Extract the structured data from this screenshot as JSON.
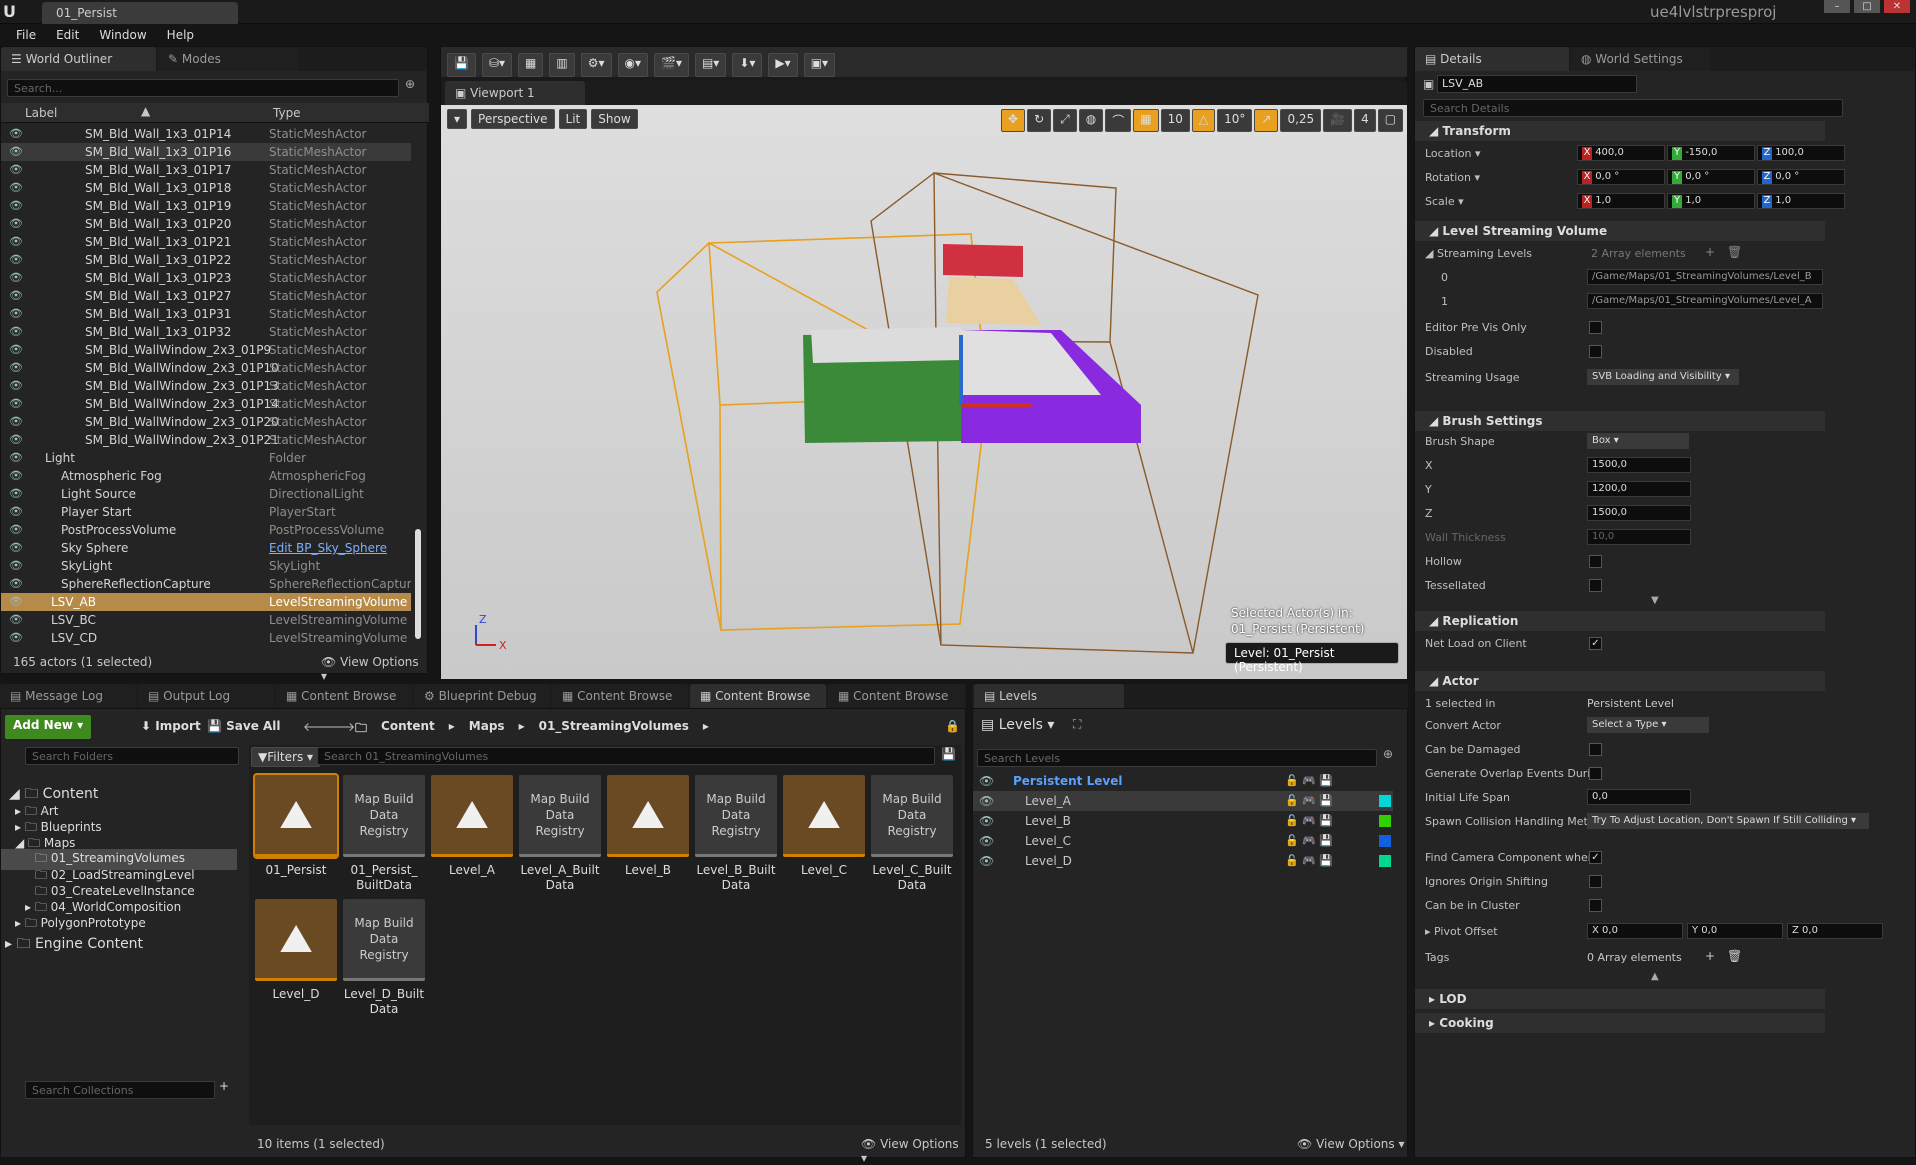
{
  "app": {
    "tab_title": "01_Persist",
    "project": "ue4lvlstrpresproj"
  },
  "menu": [
    "File",
    "Edit",
    "Window",
    "Help"
  ],
  "left_tabs": [
    "World Outliner",
    "Modes"
  ],
  "outliner": {
    "search_placeholder": "Search...",
    "col_label": "Label",
    "col_type": "Type",
    "rows": [
      {
        "label": "SM_Bld_Wall_1x3_01P14",
        "type": "StaticMeshActor"
      },
      {
        "label": "SM_Bld_Wall_1x3_01P16",
        "type": "StaticMeshActor"
      },
      {
        "label": "SM_Bld_Wall_1x3_01P17",
        "type": "StaticMeshActor"
      },
      {
        "label": "SM_Bld_Wall_1x3_01P18",
        "type": "StaticMeshActor"
      },
      {
        "label": "SM_Bld_Wall_1x3_01P19",
        "type": "StaticMeshActor"
      },
      {
        "label": "SM_Bld_Wall_1x3_01P20",
        "type": "StaticMeshActor"
      },
      {
        "label": "SM_Bld_Wall_1x3_01P21",
        "type": "StaticMeshActor"
      },
      {
        "label": "SM_Bld_Wall_1x3_01P22",
        "type": "StaticMeshActor"
      },
      {
        "label": "SM_Bld_Wall_1x3_01P23",
        "type": "StaticMeshActor"
      },
      {
        "label": "SM_Bld_Wall_1x3_01P27",
        "type": "StaticMeshActor"
      },
      {
        "label": "SM_Bld_Wall_1x3_01P31",
        "type": "StaticMeshActor"
      },
      {
        "label": "SM_Bld_Wall_1x3_01P32",
        "type": "StaticMeshActor"
      },
      {
        "label": "SM_Bld_WallWindow_2x3_01P9",
        "type": "StaticMeshActor"
      },
      {
        "label": "SM_Bld_WallWindow_2x3_01P10",
        "type": "StaticMeshActor"
      },
      {
        "label": "SM_Bld_WallWindow_2x3_01P13",
        "type": "StaticMeshActor"
      },
      {
        "label": "SM_Bld_WallWindow_2x3_01P14",
        "type": "StaticMeshActor"
      },
      {
        "label": "SM_Bld_WallWindow_2x3_01P20",
        "type": "StaticMeshActor"
      },
      {
        "label": "SM_Bld_WallWindow_2x3_01P21",
        "type": "StaticMeshActor"
      },
      {
        "label": "Light",
        "type": "Folder"
      },
      {
        "label": "Atmospheric Fog",
        "type": "AtmosphericFog"
      },
      {
        "label": "Light Source",
        "type": "DirectionalLight"
      },
      {
        "label": "Player Start",
        "type": "PlayerStart"
      },
      {
        "label": "PostProcessVolume",
        "type": "PostProcessVolume"
      },
      {
        "label": "Sky Sphere",
        "type": "Edit BP_Sky_Sphere"
      },
      {
        "label": "SkyLight",
        "type": "SkyLight"
      },
      {
        "label": "SphereReflectionCapture",
        "type": "SphereReflectionCapture"
      },
      {
        "label": "LSV_AB",
        "type": "LevelStreamingVolume"
      },
      {
        "label": "LSV_BC",
        "type": "LevelStreamingVolume"
      },
      {
        "label": "LSV_CD",
        "type": "LevelStreamingVolume"
      }
    ],
    "status": "165 actors (1 selected)",
    "view_options": "View Options"
  },
  "viewport": {
    "tab": "Viewport 1",
    "perspective": "Perspective",
    "lit": "Lit",
    "show": "Show",
    "grid": "10",
    "rot": "10°",
    "scale": "0,25",
    "speed": "4",
    "selected_line1": "Selected Actor(s) in:",
    "selected_line2": "01_Persist (Persistent)",
    "level_label": "Level:  01_Persist (Persistent)"
  },
  "bottom_tabs": [
    "Message Log",
    "Output Log",
    "Content Browse",
    "Blueprint Debug",
    "Content Browse",
    "Content Browse",
    "Content Browse"
  ],
  "content": {
    "add_new": "Add New",
    "import": "Import",
    "save_all": "Save All",
    "path": [
      "Content",
      "Maps",
      "01_StreamingVolumes"
    ],
    "search_folders": "Search Folders",
    "filters": "Filters",
    "search_assets": "Search 01_StreamingVolumes",
    "folders": [
      "Content",
      "Art",
      "Blueprints",
      "Maps",
      "01_StreamingVolumes",
      "02_LoadStreamingLevel",
      "03_CreateLevelInstance",
      "04_WorldComposition",
      "PolygonPrototype",
      "Engine Content"
    ],
    "assets": [
      {
        "name": "01_Persist",
        "kind": "map"
      },
      {
        "name": "01_Persist_ BuiltData",
        "kind": "reg"
      },
      {
        "name": "Level_A",
        "kind": "map"
      },
      {
        "name": "Level_A_Built Data",
        "kind": "reg"
      },
      {
        "name": "Level_B",
        "kind": "map"
      },
      {
        "name": "Level_B_Built Data",
        "kind": "reg"
      },
      {
        "name": "Level_C",
        "kind": "map"
      },
      {
        "name": "Level_C_Built Data",
        "kind": "reg"
      },
      {
        "name": "Level_D",
        "kind": "map"
      },
      {
        "name": "Level_D_Built Data",
        "kind": "reg"
      }
    ],
    "registry_label": "Map Build Data Registry",
    "search_collections": "Search Collections",
    "status": "10 items (1 selected)",
    "view_options": "View Options"
  },
  "levels": {
    "tab": "Levels",
    "title": "Levels",
    "search": "Search Levels",
    "rows": [
      {
        "name": "Persistent Level",
        "color": ""
      },
      {
        "name": "Level_A",
        "color": "#00d8d8"
      },
      {
        "name": "Level_B",
        "color": "#30d000"
      },
      {
        "name": "Level_C",
        "color": "#1060e0"
      },
      {
        "name": "Level_D",
        "color": "#00d890"
      }
    ],
    "status": "5 levels (1 selected)",
    "view_options": "View Options"
  },
  "details": {
    "tabs": [
      "Details",
      "World Settings"
    ],
    "actor_name": "LSV_AB",
    "search": "Search Details",
    "transform": {
      "title": "Transform",
      "location_label": "Location",
      "rotation_label": "Rotation",
      "scale_label": "Scale",
      "location": [
        "400,0",
        "-150,0",
        "100,0"
      ],
      "rotation": [
        "0,0 °",
        "0,0 °",
        "0,0 °"
      ],
      "scale": [
        "1,0",
        "1,0",
        "1,0"
      ]
    },
    "lsv": {
      "title": "Level Streaming Volume",
      "streaming_levels": "Streaming Levels",
      "array": "2 Array elements",
      "idx0": "0",
      "idx1": "1",
      "path0": "/Game/Maps/01_StreamingVolumes/Level_B",
      "path1": "/Game/Maps/01_StreamingVolumes/Level_A",
      "editor_pre_vis": "Editor Pre Vis Only",
      "disabled": "Disabled",
      "usage_label": "Streaming Usage",
      "usage": "SVB Loading and Visibility"
    },
    "brush": {
      "title": "Brush Settings",
      "shape_label": "Brush Shape",
      "shape": "Box",
      "x": "1500,0",
      "y": "1200,0",
      "z": "1500,0",
      "wall_label": "Wall Thickness",
      "wall": "10,0",
      "hollow": "Hollow",
      "tessellated": "Tessellated"
    },
    "replication": {
      "title": "Replication",
      "net_load": "Net Load on Client"
    },
    "actor": {
      "title": "Actor",
      "selected_in": "1 selected in",
      "selected_in_val": "Persistent Level",
      "convert": "Convert Actor",
      "convert_val": "Select a Type",
      "damaged": "Can be Damaged",
      "overlap": "Generate Overlap Events Durin",
      "lifespan": "Initial Life Span",
      "lifespan_val": "0,0",
      "spawn": "Spawn Collision Handling Meth",
      "spawn_val": "Try To Adjust Location, Don't Spawn If Still Colliding",
      "find_camera": "Find Camera Component when",
      "ignores_origin": "Ignores Origin Shifting",
      "cluster": "Can be in Cluster",
      "pivot": "Pivot Offset",
      "pivot_vals": [
        "0,0",
        "0,0",
        "0,0"
      ],
      "tags": "Tags",
      "tags_val": "0 Array elements"
    },
    "lod": "LOD",
    "cooking": "Cooking"
  }
}
